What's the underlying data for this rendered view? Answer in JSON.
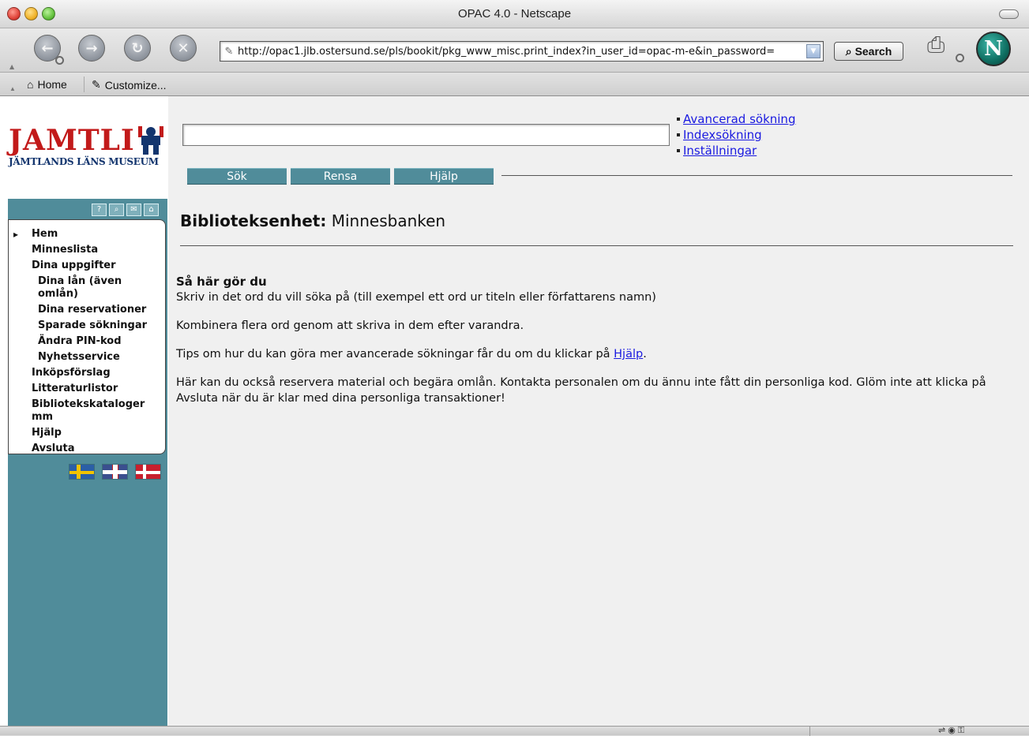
{
  "window": {
    "title": "OPAC 4.0 - Netscape"
  },
  "toolbar": {
    "url": "http://opac1.jlb.ostersund.se/pls/bookit/pkg_www_misc.print_index?in_user_id=opac-m-e&in_password=",
    "search_label": "Search"
  },
  "personal_toolbar": {
    "home_label": "Home",
    "customize_label": "Customize..."
  },
  "logo": {
    "name": "JAMTLI",
    "subtitle": "JÄMTLANDS LÄNS MUSEUM"
  },
  "sidebar": {
    "icons": [
      "help-icon",
      "search-icon",
      "mail-icon",
      "home-icon"
    ],
    "items": [
      {
        "label": "Hem",
        "current": true
      },
      {
        "label": "Minneslista"
      },
      {
        "label": "Dina uppgifter"
      },
      {
        "label": "Dina lån (även omlån)",
        "sub": true
      },
      {
        "label": "Dina reservationer",
        "sub": true
      },
      {
        "label": "Sparade sökningar",
        "sub": true
      },
      {
        "label": "Ändra PIN-kod",
        "sub": true
      },
      {
        "label": "Nyhetsservice",
        "sub": true
      },
      {
        "label": "Inköpsförslag"
      },
      {
        "label": "Litteraturlistor"
      },
      {
        "label": "Bibliotekskataloger mm"
      },
      {
        "label": "Hjälp"
      },
      {
        "label": "Avsluta"
      }
    ],
    "languages": [
      "Svenska",
      "English",
      "Dansk"
    ]
  },
  "search": {
    "value": "",
    "buttons": {
      "search": "Sök",
      "clear": "Rensa",
      "help": "Hjälp"
    },
    "links": [
      "Avancerad sökning",
      "Indexsökning",
      "Inställningar"
    ]
  },
  "main": {
    "heading_label": "Biblioteksenhet:",
    "heading_value": "Minnesbanken",
    "howto_title": "Så här gör du",
    "p1": "Skriv in det ord du vill söka på (till exempel ett ord ur titeln eller författarens namn)",
    "p2": "Kombinera flera ord genom att skriva in dem efter varandra.",
    "p3_before": "Tips om hur du kan göra mer avancerade sökningar får du om du klickar på ",
    "p3_link": "Hjälp",
    "p3_after": ".",
    "p4": "Här kan du också reservera material och begära omlån. Kontakta personalen om du ännu inte fått din personliga kod. Glöm inte att klicka på Avsluta när du är klar med dina personliga transaktioner!"
  },
  "colors": {
    "accent_teal": "#508c9a",
    "logo_red": "#c21a1a",
    "link_blue": "#1a1ae0"
  }
}
